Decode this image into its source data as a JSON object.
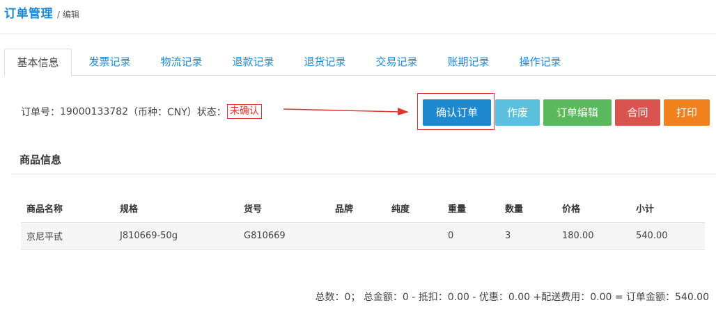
{
  "breadcrumb": {
    "title": "订单管理",
    "separator": "/",
    "current": "编辑"
  },
  "tabs": [
    {
      "label": "基本信息",
      "active": true
    },
    {
      "label": "发票记录"
    },
    {
      "label": "物流记录"
    },
    {
      "label": "退款记录"
    },
    {
      "label": "退货记录"
    },
    {
      "label": "交易记录"
    },
    {
      "label": "账期记录"
    },
    {
      "label": "操作记录"
    }
  ],
  "order": {
    "number_label": "订单号：",
    "number": "19000133782",
    "currency_text": "（币种：CNY）",
    "status_label": "状态：",
    "status": "未确认"
  },
  "actions": {
    "confirm": "确认订单",
    "void": "作废",
    "edit": "订单编辑",
    "contract": "合同",
    "print": "打印"
  },
  "products": {
    "title": "商品信息",
    "columns": [
      "商品名称",
      "规格",
      "货号",
      "品牌",
      "纯度",
      "重量",
      "数量",
      "价格",
      "小计"
    ],
    "rows": [
      [
        "京尼平甙",
        "J810669-50g",
        "G810669",
        "",
        "",
        "0",
        "3",
        "180.00",
        "540.00"
      ]
    ]
  },
  "summary": "总数：0； 总金额：0 - 抵扣：0.00 - 优惠：0.00 +配送费用：0.00 = 订单金额：540.00",
  "colors": {
    "link": "#1e8ad6",
    "confirm": "#1e89cf",
    "void": "#5bc0de",
    "edit": "#5cb85c",
    "contract": "#d9534f",
    "print": "#f0811c",
    "annotation": "#e0352f"
  }
}
